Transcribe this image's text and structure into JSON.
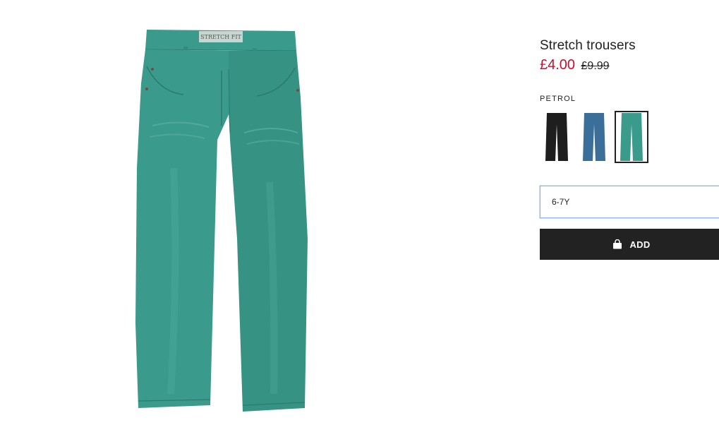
{
  "product": {
    "title": "Stretch trousers",
    "price_sale": "£4.00",
    "price_old": "£9.99",
    "image_label": "STRETCH FIT",
    "image_color": "#3a9a8c"
  },
  "colors": {
    "selected_name": "PETROL",
    "swatches": [
      {
        "name": "black",
        "hex": "#1e1e1e",
        "selected": false
      },
      {
        "name": "blue",
        "hex": "#3b6f9a",
        "selected": false
      },
      {
        "name": "petrol",
        "hex": "#3a9a8c",
        "selected": true
      }
    ]
  },
  "size": {
    "selected_value": "6-7Y"
  },
  "actions": {
    "add_label": "ADD",
    "add_icon": "shopping-bag-icon"
  }
}
